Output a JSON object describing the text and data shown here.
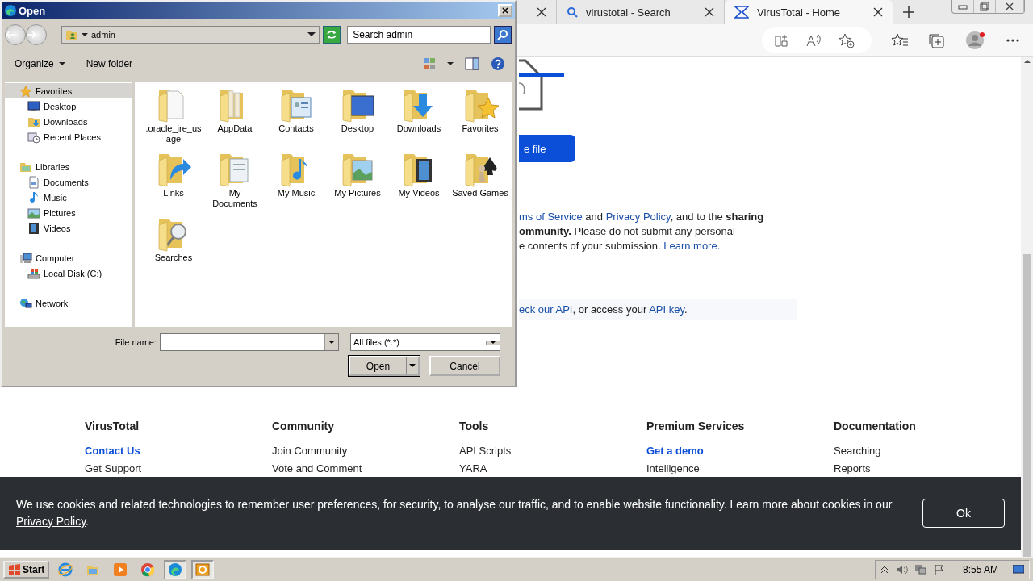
{
  "browser": {
    "tabs": [
      {
        "kind": "blank",
        "selected": false
      },
      {
        "kind": "search",
        "label": "virustotal - Search",
        "selected": false
      },
      {
        "kind": "site",
        "label": "VirusTotal - Home",
        "selected": true
      }
    ],
    "page": {
      "upload_button": "e file",
      "terms_lines": [
        [
          {
            "text": "ms of Service",
            "kind": "link"
          },
          {
            "text": " and ",
            "kind": "plain"
          },
          {
            "text": "Privacy Policy",
            "kind": "link"
          },
          {
            "text": ", and to the ",
            "kind": "plain"
          },
          {
            "text": "sharing",
            "kind": "bold"
          }
        ],
        [
          {
            "text": "ommunity.",
            "kind": "bold"
          },
          {
            "text": " Please do not submit any personal",
            "kind": "plain"
          }
        ],
        [
          {
            "text": "e contents of your submission. ",
            "kind": "plain"
          },
          {
            "text": "Learn more.",
            "kind": "link"
          }
        ]
      ],
      "api_line": [
        {
          "text": "eck our API",
          "kind": "link"
        },
        {
          "text": ", or access your ",
          "kind": "plain"
        },
        {
          "text": "API key",
          "kind": "link"
        },
        {
          "text": ".",
          "kind": "plain"
        }
      ]
    },
    "footer": [
      {
        "title": "VirusTotal",
        "links": [
          {
            "label": "Contact Us",
            "kind": "accent"
          },
          {
            "label": "Get Support",
            "kind": "plain"
          }
        ]
      },
      {
        "title": "Community",
        "links": [
          {
            "label": "Join Community",
            "kind": "plain"
          },
          {
            "label": "Vote and Comment",
            "kind": "plain"
          }
        ]
      },
      {
        "title": "Tools",
        "links": [
          {
            "label": "API Scripts",
            "kind": "plain"
          },
          {
            "label": "YARA",
            "kind": "plain"
          }
        ]
      },
      {
        "title": "Premium Services",
        "links": [
          {
            "label": "Get a demo",
            "kind": "accent"
          },
          {
            "label": "Intelligence",
            "kind": "plain"
          }
        ]
      },
      {
        "title": "Documentation",
        "links": [
          {
            "label": "Searching",
            "kind": "plain"
          },
          {
            "label": "Reports",
            "kind": "plain"
          }
        ]
      }
    ],
    "cookie_banner": {
      "text": "We use cookies and related technologies to remember user preferences, for security, to analyse our traffic, and to enable website functionality. Learn more about cookies in our",
      "link": "Privacy Policy",
      "tail": ".",
      "button": "Ok"
    }
  },
  "dialog": {
    "title": "Open",
    "location": "admin",
    "search": {
      "placeholder": "Search admin"
    },
    "toolbar": [
      {
        "label": "Organize",
        "kind": "menu"
      },
      {
        "label": "New folder",
        "kind": "button"
      }
    ],
    "nav": [
      {
        "label": "Favorites",
        "kind": "star",
        "selected": true,
        "children": [
          {
            "label": "Desktop",
            "kind": "desktop",
            "selected": false
          },
          {
            "label": "Downloads",
            "kind": "downloads",
            "selected": false
          },
          {
            "label": "Recent Places",
            "kind": "recent",
            "selected": false
          }
        ]
      },
      {
        "label": "Libraries",
        "kind": "library",
        "selected": false,
        "children": [
          {
            "label": "Documents",
            "kind": "document",
            "selected": false
          },
          {
            "label": "Music",
            "kind": "music",
            "selected": false
          },
          {
            "label": "Pictures",
            "kind": "picture",
            "selected": false
          },
          {
            "label": "Videos",
            "kind": "video",
            "selected": false
          }
        ]
      },
      {
        "label": "Computer",
        "kind": "computer",
        "selected": false,
        "children": [
          {
            "label": "Local Disk (C:)",
            "kind": "disk",
            "selected": false
          }
        ]
      },
      {
        "label": "Network",
        "kind": "network",
        "selected": false
      }
    ],
    "items": [
      {
        "label": ".oracle_jre_usage",
        "kind": "document"
      },
      {
        "label": "AppData",
        "kind": "stack"
      },
      {
        "label": "Contacts",
        "kind": "contact"
      },
      {
        "label": "Desktop",
        "kind": "desktop"
      },
      {
        "label": "Downloads",
        "kind": "download"
      },
      {
        "label": "Favorites",
        "kind": "star"
      },
      {
        "label": "Links",
        "kind": "link"
      },
      {
        "label": "My Documents",
        "kind": "pages"
      },
      {
        "label": "My Music",
        "kind": "music"
      },
      {
        "label": "My Pictures",
        "kind": "picture"
      },
      {
        "label": "My Videos",
        "kind": "video"
      },
      {
        "label": "Saved Games",
        "kind": "game"
      },
      {
        "label": "Searches",
        "kind": "search"
      }
    ],
    "file_name": {
      "label": "File name:"
    },
    "filter": "All files (*.*)",
    "buttons": [
      {
        "label": "Open",
        "kind": "split"
      },
      {
        "label": "Cancel",
        "kind": "plain"
      }
    ]
  },
  "taskbar": {
    "start": "Start",
    "apps": [
      {
        "kind": "ie",
        "selected": false
      },
      {
        "kind": "explorer",
        "selected": false
      },
      {
        "kind": "media",
        "selected": false
      },
      {
        "kind": "chrome",
        "selected": false
      },
      {
        "kind": "edge",
        "selected": true
      },
      {
        "kind": "outlook",
        "selected": true
      }
    ],
    "clock": "8:55 AM"
  }
}
